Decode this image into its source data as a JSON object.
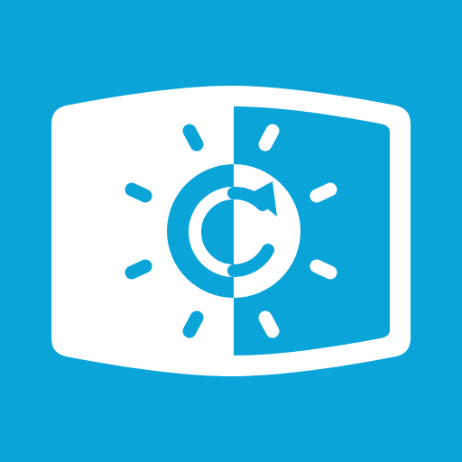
{
  "icon": {
    "name": "display-brightness-refresh-icon",
    "background_color": "#0aa4d9",
    "foreground_color": "#ffffff",
    "parts": [
      "monitor-icon",
      "sun-icon",
      "refresh-arrow-icon"
    ]
  }
}
